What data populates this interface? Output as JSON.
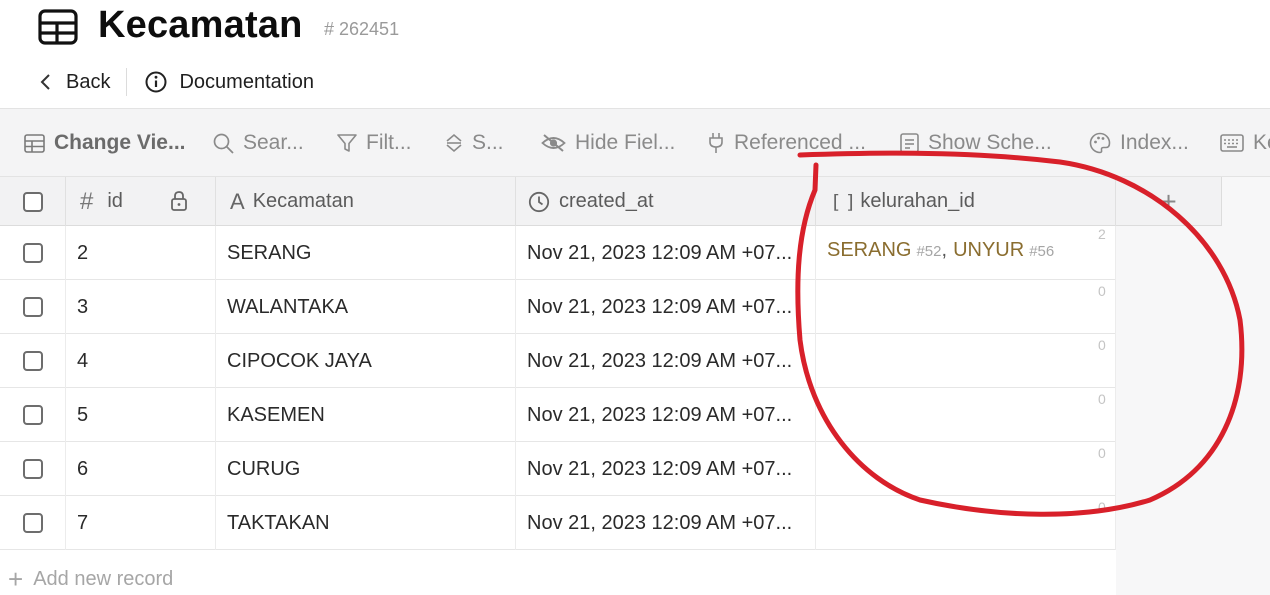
{
  "header": {
    "title": "Kecamatan",
    "table_id": "# 262451",
    "back_label": "Back",
    "documentation_label": "Documentation"
  },
  "toolbar": {
    "items": [
      {
        "label": "Change Vie...",
        "icon": "table-view-icon"
      },
      {
        "label": "Sear...",
        "icon": "search-icon"
      },
      {
        "label": "Filt...",
        "icon": "filter-icon"
      },
      {
        "label": "S...",
        "icon": "sort-icon"
      },
      {
        "label": "Hide Fiel...",
        "icon": "eye-off-icon"
      },
      {
        "label": "Referenced ...",
        "icon": "plug-icon"
      },
      {
        "label": "Show Sche...",
        "icon": "schema-icon"
      },
      {
        "label": "Index...",
        "icon": "palette-icon"
      },
      {
        "label": "Ke",
        "icon": "keyboard-icon"
      }
    ]
  },
  "columns": {
    "id": "id",
    "id_symbol": "#",
    "kecamatan": "Kecamatan",
    "kecamatan_symbol": "A",
    "created_at": "created_at",
    "kelurahan_id": "kelurahan_id",
    "kelurahan_symbol": "[ ]",
    "add_symbol": "+"
  },
  "rows": [
    {
      "id": "2",
      "kecamatan": "SERANG",
      "created_at": "Nov 21, 2023 12:09 AM +07...",
      "count": "2",
      "refs": [
        {
          "name": "SERANG",
          "ref": "#52",
          "sep": ","
        },
        {
          "name": "UNYUR",
          "ref": "#56",
          "sep": ""
        }
      ]
    },
    {
      "id": "3",
      "kecamatan": "WALANTAKA",
      "created_at": "Nov 21, 2023 12:09 AM +07...",
      "count": "0",
      "refs": []
    },
    {
      "id": "4",
      "kecamatan": "CIPOCOK JAYA",
      "created_at": "Nov 21, 2023 12:09 AM +07...",
      "count": "0",
      "refs": []
    },
    {
      "id": "5",
      "kecamatan": "KASEMEN",
      "created_at": "Nov 21, 2023 12:09 AM +07...",
      "count": "0",
      "refs": []
    },
    {
      "id": "6",
      "kecamatan": "CURUG",
      "created_at": "Nov 21, 2023 12:09 AM +07...",
      "count": "0",
      "refs": []
    },
    {
      "id": "7",
      "kecamatan": "TAKTAKAN",
      "created_at": "Nov 21, 2023 12:09 AM +07...",
      "count": "0",
      "refs": []
    }
  ],
  "footer": {
    "add_record_label": "Add new record",
    "add_symbol": "+"
  },
  "colors": {
    "annotation": "#d8202a",
    "reference_text": "#8a6d2f",
    "toolbar_bg": "#f4f4f5"
  }
}
